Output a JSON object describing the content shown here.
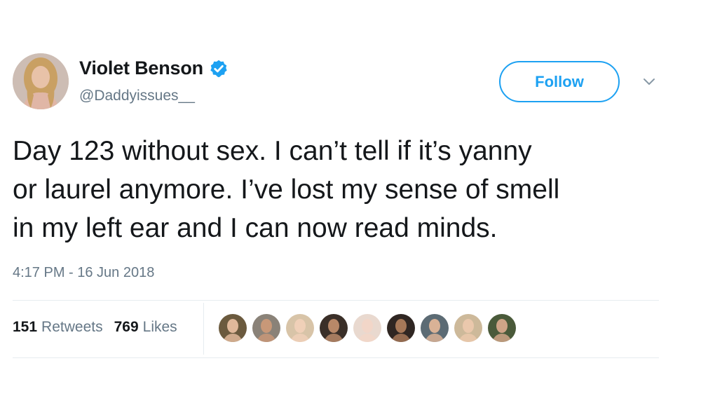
{
  "user": {
    "display_name": "Violet Benson",
    "handle": "@Daddyissues__",
    "verified": true,
    "avatar_icon": "profile-photo"
  },
  "follow_button": {
    "label": "Follow"
  },
  "menu": {
    "icon": "chevron-down-icon"
  },
  "tweet": {
    "text": "Day 123 without sex. I can’t tell if it’s yanny\nor laurel anymore. I’ve lost my sense of smell\nin my left ear and I can now read minds.",
    "timestamp": "4:17 PM - 16 Jun 2018"
  },
  "stats": {
    "retweets": {
      "count": "151",
      "label": "Retweets"
    },
    "likes": {
      "count": "769",
      "label": "Likes"
    }
  },
  "likers": [
    {
      "name": "liker-1",
      "bg": "#6b5a3e"
    },
    {
      "name": "liker-2",
      "bg": "#8a8278"
    },
    {
      "name": "liker-3",
      "bg": "#d8c4a8"
    },
    {
      "name": "liker-4",
      "bg": "#3a2f28"
    },
    {
      "name": "liker-5",
      "bg": "#e9d9cf"
    },
    {
      "name": "liker-6",
      "bg": "#2f2622"
    },
    {
      "name": "liker-7",
      "bg": "#5c6b74"
    },
    {
      "name": "liker-8",
      "bg": "#cdb99a"
    },
    {
      "name": "liker-9",
      "bg": "#4a5a3a"
    }
  ],
  "colors": {
    "accent": "#1da1f2",
    "text": "#14171a",
    "secondary": "#657786",
    "divider": "#e6ecf0"
  }
}
